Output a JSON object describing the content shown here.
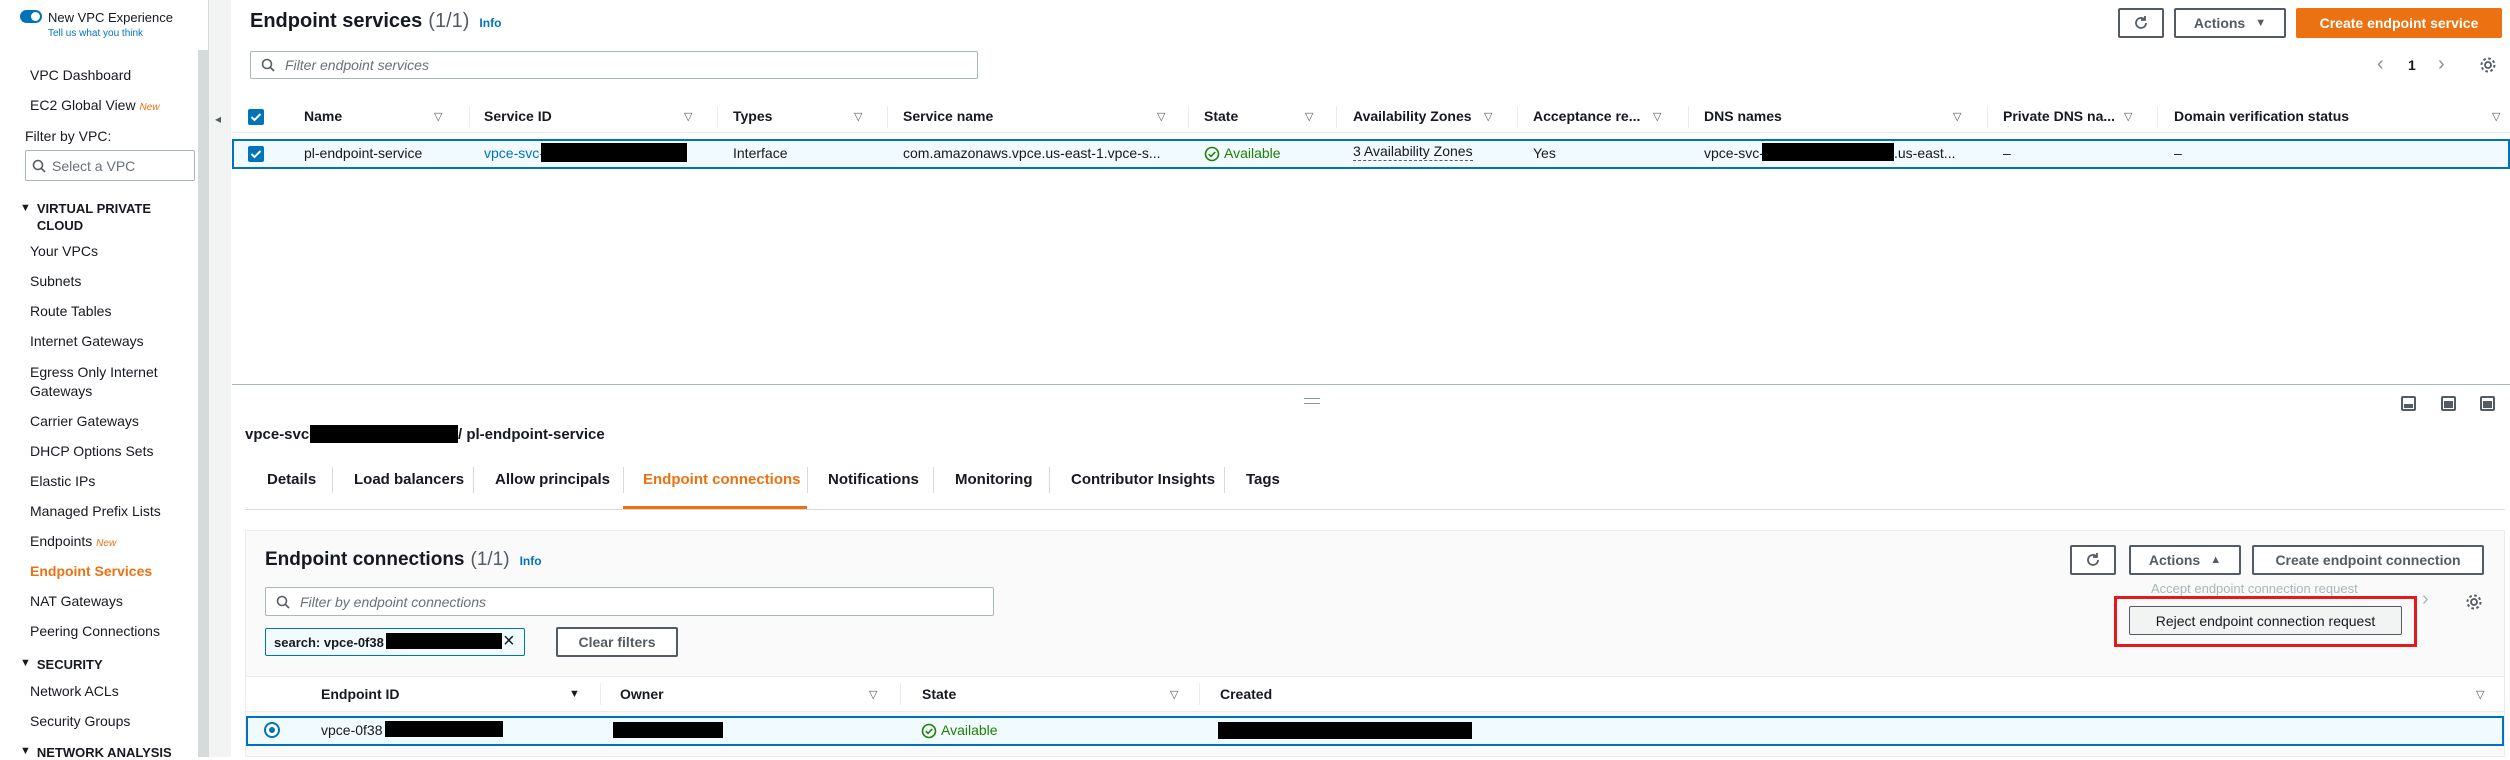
{
  "sidebar": {
    "toggle_label": "New VPC Experience",
    "toggle_link": "Tell us what you think",
    "items_top": [
      {
        "label": "VPC Dashboard"
      },
      {
        "label": "EC2 Global View",
        "badge": "New"
      }
    ],
    "filter_label": "Filter by VPC:",
    "filter_placeholder": "Select a VPC",
    "section_vpc": "VIRTUAL PRIVATE CLOUD",
    "vpc_items": [
      {
        "label": "Your VPCs"
      },
      {
        "label": "Subnets"
      },
      {
        "label": "Route Tables"
      },
      {
        "label": "Internet Gateways"
      },
      {
        "label": "Egress Only Internet Gateways"
      },
      {
        "label": "Carrier Gateways"
      },
      {
        "label": "DHCP Options Sets"
      },
      {
        "label": "Elastic IPs"
      },
      {
        "label": "Managed Prefix Lists"
      },
      {
        "label": "Endpoints",
        "badge": "New"
      },
      {
        "label": "Endpoint Services"
      },
      {
        "label": "NAT Gateways"
      },
      {
        "label": "Peering Connections"
      }
    ],
    "section_security": "SECURITY",
    "security_items": [
      {
        "label": "Network ACLs"
      },
      {
        "label": "Security Groups"
      }
    ],
    "section_network": "NETWORK ANALYSIS"
  },
  "top": {
    "title": "Endpoint services",
    "count": "(1/1)",
    "info": "Info",
    "actions_label": "Actions",
    "create_label": "Create endpoint service",
    "filter_placeholder": "Filter endpoint services",
    "page_number": "1",
    "columns": [
      "Name",
      "Service ID",
      "Types",
      "Service name",
      "State",
      "Availability Zones",
      "Acceptance re...",
      "DNS names",
      "Private DNS na...",
      "Domain verification status"
    ],
    "row": {
      "name": "pl-endpoint-service",
      "service_id": "vpce-svc-",
      "type": "Interface",
      "service_name": "com.amazonaws.vpce.us-east-1.vpce-s...",
      "state": "Available",
      "azs": "3 Availability Zones",
      "acceptance": "Yes",
      "dns_prefix": "vpce-svc-",
      "dns_suffix": ".us-east...",
      "private_dns": "–",
      "domain_status": "–"
    }
  },
  "detail": {
    "title_prefix": "vpce-svc-",
    "title_suffix": "/ pl-endpoint-service",
    "tabs": [
      "Details",
      "Load balancers",
      "Allow principals",
      "Endpoint connections",
      "Notifications",
      "Monitoring",
      "Contributor Insights",
      "Tags"
    ],
    "active_tab": "Endpoint connections"
  },
  "connections": {
    "title": "Endpoint connections",
    "count": "(1/1)",
    "info": "Info",
    "actions_label": "Actions",
    "create_label": "Create endpoint connection",
    "filter_placeholder": "Filter by endpoint connections",
    "search_token_prefix": "search: vpce-0f38",
    "clear_filters": "Clear filters",
    "menu_accept": "Accept endpoint connection request",
    "menu_reject": "Reject endpoint connection request",
    "columns": [
      "Endpoint ID",
      "Owner",
      "State",
      "Created"
    ],
    "row": {
      "endpoint_id_prefix": "vpce-0f38",
      "state": "Available"
    }
  },
  "colors": {
    "accent": "#ec7211",
    "link": "#0073bb",
    "selected_border": "#0073bb",
    "selected_bg": "#f1faff",
    "success": "#1d8102",
    "highlight_box": "#e51a1a"
  }
}
